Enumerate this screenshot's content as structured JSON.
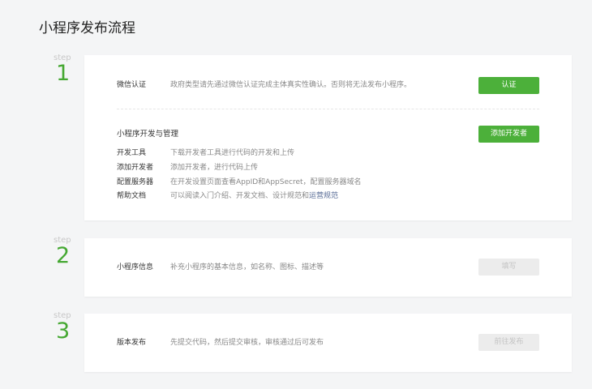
{
  "title": "小程序发布流程",
  "steps": [
    {
      "label": "step",
      "num": "1"
    },
    {
      "label": "step",
      "num": "2"
    },
    {
      "label": "step",
      "num": "3"
    }
  ],
  "s1": {
    "key": "微信认证",
    "desc": "政府类型请先通过微信认证完成主体真实性确认。否则将无法发布小程序。",
    "button": "认证",
    "section": "小程序开发与管理",
    "section_button": "添加开发者",
    "items": [
      {
        "key": "开发工具",
        "desc": "下载开发者工具进行代码的开发和上传"
      },
      {
        "key": "添加开发者",
        "desc": "添加开发者，进行代码上传"
      },
      {
        "key": "配置服务器",
        "desc": "在开发设置页面查看AppID和AppSecret，配置服务器域名"
      },
      {
        "key": "帮助文档",
        "desc": "可以阅读入门介绍、开发文档、设计规范和",
        "link": "运营规范"
      }
    ]
  },
  "s2": {
    "key": "小程序信息",
    "desc": "补充小程序的基本信息，如名称、图标、描述等",
    "button": "填写"
  },
  "s3": {
    "key": "版本发布",
    "desc": "先提交代码，然后提交审核，审核通过后可发布",
    "button": "前往发布"
  }
}
